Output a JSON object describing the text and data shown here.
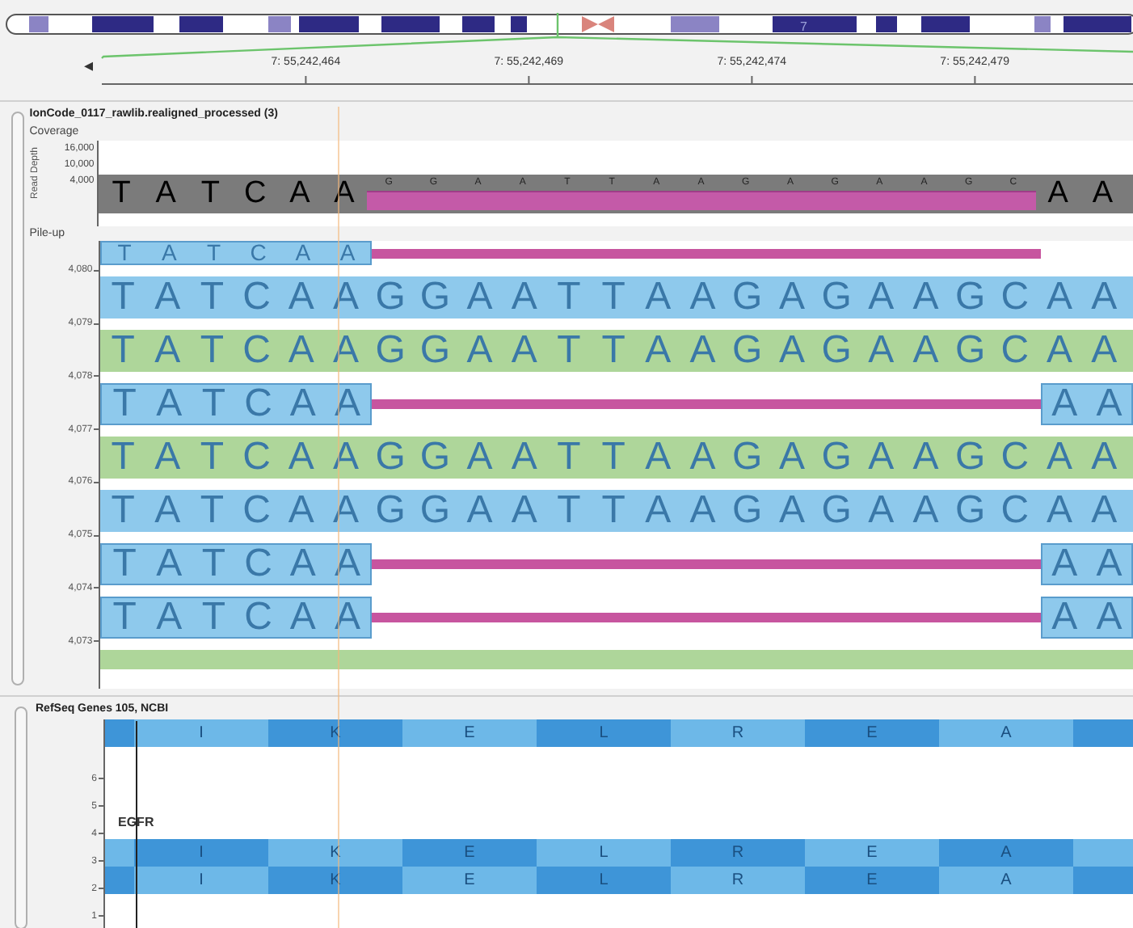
{
  "ideogram": {
    "chromosome": "7"
  },
  "ruler": {
    "back": "◂",
    "ticks": [
      "7: 55,242,464",
      "7: 55,242,469",
      "7: 55,242,474",
      "7: 55,242,479"
    ]
  },
  "alignment_track": {
    "title": "IonCode_0117_rawlib.realigned_processed (3)",
    "coverage": {
      "label": "Coverage",
      "axis_title": "Read Depth",
      "ticks": [
        "16,000",
        "10,000",
        "4,000"
      ],
      "left": "T A T C A A",
      "deleted": "G G A A T T A A G A G A A G C",
      "right": "A A"
    },
    "pileup": {
      "label": "Pile-up",
      "ticks": [
        "4,080",
        "4,079",
        "4,078",
        "4,077",
        "4,076",
        "4,075",
        "4,074",
        "4,073"
      ],
      "reads": [
        {
          "kind": "deletion",
          "color": "#8ec9ec",
          "left": "T A T C A A"
        },
        {
          "kind": "full",
          "color": "#8ec9ec",
          "bases": "T A T C A A G G A A T T A A G A G A A G C A A"
        },
        {
          "kind": "full",
          "color": "#aed69a",
          "bases": "T A T C A A G G A A T T A A G A G A A G C A A"
        },
        {
          "kind": "deletion",
          "color": "#8ec9ec",
          "left": "T A T C A A",
          "right": "A A"
        },
        {
          "kind": "full",
          "color": "#aed69a",
          "bases": "T A T C A A G G A A T T A A G A G A A G C A A"
        },
        {
          "kind": "full",
          "color": "#8ec9ec",
          "bases": "T A T C A A G G A A T T A A G A G A A G C A A"
        },
        {
          "kind": "deletion",
          "color": "#8ec9ec",
          "left": "T A T C A A",
          "right": "A A"
        },
        {
          "kind": "deletion",
          "color": "#8ec9ec",
          "left": "T A T C A A",
          "right": "A A"
        },
        {
          "kind": "partial",
          "color": "#aed69a"
        }
      ]
    }
  },
  "gene_track": {
    "title": "RefSeq Genes 105, NCBI",
    "ticks": [
      "6",
      "5",
      "4",
      "3",
      "2",
      "1"
    ],
    "gene_label": "EGFR",
    "rows": [
      {
        "codons": [
          {
            "kind": "edge",
            "dark": true
          },
          {
            "kind": "codon",
            "aa": "I",
            "dark": false
          },
          {
            "kind": "codon",
            "aa": "K",
            "dark": true
          },
          {
            "kind": "codon",
            "aa": "E",
            "dark": false
          },
          {
            "kind": "codon",
            "aa": "L",
            "dark": true
          },
          {
            "kind": "codon",
            "aa": "R",
            "dark": false
          },
          {
            "kind": "codon",
            "aa": "E",
            "dark": true
          },
          {
            "kind": "codon",
            "aa": "A",
            "dark": false
          },
          {
            "kind": "edge",
            "dark": true
          }
        ]
      },
      {
        "codons": [
          {
            "kind": "edge",
            "dark": false
          },
          {
            "kind": "codon",
            "aa": "I",
            "dark": true
          },
          {
            "kind": "codon",
            "aa": "K",
            "dark": false
          },
          {
            "kind": "codon",
            "aa": "E",
            "dark": true
          },
          {
            "kind": "codon",
            "aa": "L",
            "dark": false
          },
          {
            "kind": "codon",
            "aa": "R",
            "dark": true
          },
          {
            "kind": "codon",
            "aa": "E",
            "dark": false
          },
          {
            "kind": "codon",
            "aa": "A",
            "dark": true
          },
          {
            "kind": "edge",
            "dark": false
          }
        ]
      },
      {
        "codons": [
          {
            "kind": "edge",
            "dark": true
          },
          {
            "kind": "codon",
            "aa": "I",
            "dark": false
          },
          {
            "kind": "codon",
            "aa": "K",
            "dark": true
          },
          {
            "kind": "codon",
            "aa": "E",
            "dark": false
          },
          {
            "kind": "codon",
            "aa": "L",
            "dark": true
          },
          {
            "kind": "codon",
            "aa": "R",
            "dark": false
          },
          {
            "kind": "codon",
            "aa": "E",
            "dark": true
          },
          {
            "kind": "codon",
            "aa": "A",
            "dark": false
          },
          {
            "kind": "edge",
            "dark": true
          }
        ]
      }
    ]
  }
}
